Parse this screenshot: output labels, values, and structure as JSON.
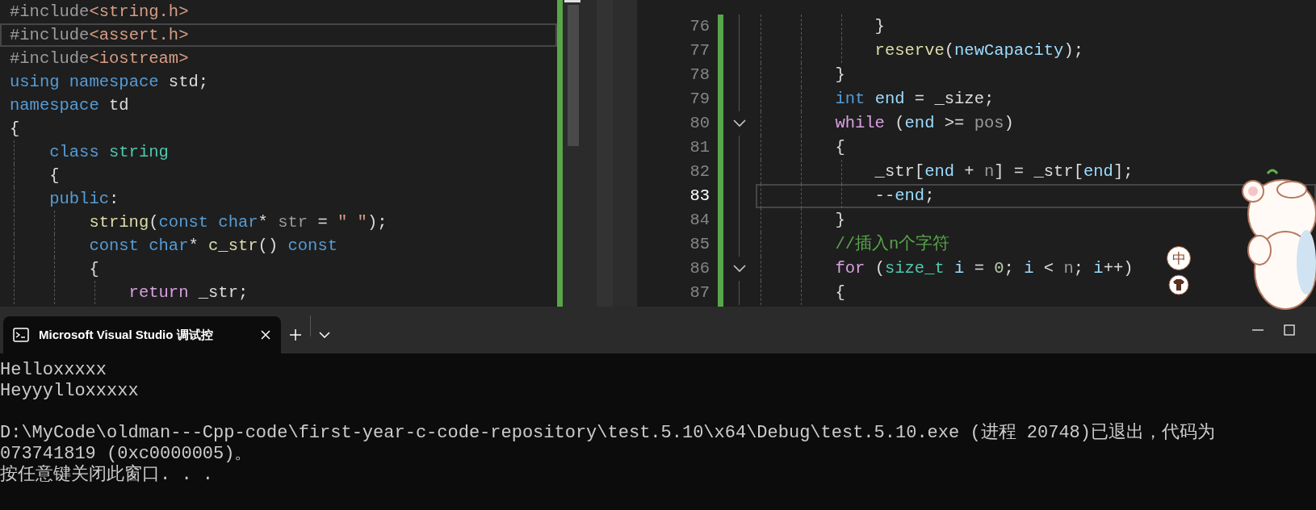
{
  "left_editor": {
    "lines": [
      {
        "current": false,
        "tokens": [
          {
            "t": "#include",
            "kind": "prep"
          },
          {
            "t": "<string.h>",
            "kind": "string"
          }
        ]
      },
      {
        "current": true,
        "tokens": [
          {
            "t": "#include",
            "kind": "prep"
          },
          {
            "t": "<assert.h>",
            "kind": "string"
          }
        ]
      },
      {
        "current": false,
        "tokens": [
          {
            "t": "#include",
            "kind": "prep"
          },
          {
            "t": "<iostream>",
            "kind": "string"
          }
        ]
      },
      {
        "current": false,
        "tokens": [
          {
            "t": "using",
            "kind": "kw"
          },
          {
            "t": " namespace",
            "kind": "kw"
          },
          {
            "t": " std;",
            "kind": "plain"
          }
        ]
      },
      {
        "current": false,
        "tokens": [
          {
            "t": "namespace",
            "kind": "kw"
          },
          {
            "t": " td",
            "kind": "plain"
          }
        ]
      },
      {
        "current": false,
        "tokens": [
          {
            "t": "{",
            "kind": "plain"
          }
        ]
      },
      {
        "current": false,
        "tokens": [
          {
            "t": "    class",
            "kind": "kw"
          },
          {
            "t": " string",
            "kind": "type"
          }
        ]
      },
      {
        "current": false,
        "tokens": [
          {
            "t": "    {",
            "kind": "plain"
          }
        ]
      },
      {
        "current": false,
        "tokens": [
          {
            "t": "    public",
            "kind": "kw"
          },
          {
            "t": ":",
            "kind": "plain"
          }
        ]
      },
      {
        "current": false,
        "tokens": [
          {
            "t": "        string",
            "kind": "func"
          },
          {
            "t": "(",
            "kind": "plain"
          },
          {
            "t": "const",
            "kind": "kw"
          },
          {
            "t": " char",
            "kind": "kw"
          },
          {
            "t": "* ",
            "kind": "plain"
          },
          {
            "t": "str",
            "kind": "param"
          },
          {
            "t": " = ",
            "kind": "plain"
          },
          {
            "t": "\" \"",
            "kind": "string"
          },
          {
            "t": ");",
            "kind": "plain"
          }
        ]
      },
      {
        "current": false,
        "tokens": [
          {
            "t": "        const",
            "kind": "kw"
          },
          {
            "t": " char",
            "kind": "kw"
          },
          {
            "t": "* ",
            "kind": "plain"
          },
          {
            "t": "c_str",
            "kind": "func"
          },
          {
            "t": "() ",
            "kind": "plain"
          },
          {
            "t": "const",
            "kind": "kw"
          }
        ]
      },
      {
        "current": false,
        "tokens": [
          {
            "t": "        {",
            "kind": "plain"
          }
        ]
      },
      {
        "current": false,
        "tokens": [
          {
            "t": "            return",
            "kind": "ctrl"
          },
          {
            "t": " _str;",
            "kind": "plain"
          }
        ]
      }
    ]
  },
  "right_editor": {
    "lines": [
      {
        "number": "76",
        "current": false,
        "foldable": false,
        "tokens": [
          {
            "t": "            }",
            "kind": "plain"
          }
        ]
      },
      {
        "number": "77",
        "current": false,
        "foldable": false,
        "tokens": [
          {
            "t": "            reserve",
            "kind": "func"
          },
          {
            "t": "(",
            "kind": "plain"
          },
          {
            "t": "newCapacity",
            "kind": "var"
          },
          {
            "t": ");",
            "kind": "plain"
          }
        ]
      },
      {
        "number": "78",
        "current": false,
        "foldable": false,
        "tokens": [
          {
            "t": "        }",
            "kind": "plain"
          }
        ]
      },
      {
        "number": "79",
        "current": false,
        "foldable": false,
        "tokens": [
          {
            "t": "        int",
            "kind": "kw"
          },
          {
            "t": " end",
            "kind": "var"
          },
          {
            "t": " = _size;",
            "kind": "plain"
          }
        ]
      },
      {
        "number": "80",
        "current": false,
        "foldable": true,
        "tokens": [
          {
            "t": "        while",
            "kind": "ctrl"
          },
          {
            "t": " (",
            "kind": "plain"
          },
          {
            "t": "end",
            "kind": "var"
          },
          {
            "t": " >= ",
            "kind": "plain"
          },
          {
            "t": "pos",
            "kind": "param"
          },
          {
            "t": ")",
            "kind": "plain"
          }
        ]
      },
      {
        "number": "81",
        "current": false,
        "foldable": false,
        "tokens": [
          {
            "t": "        {",
            "kind": "plain"
          }
        ]
      },
      {
        "number": "82",
        "current": false,
        "foldable": false,
        "tokens": [
          {
            "t": "            _str[",
            "kind": "plain"
          },
          {
            "t": "end",
            "kind": "var"
          },
          {
            "t": " + ",
            "kind": "plain"
          },
          {
            "t": "n",
            "kind": "param"
          },
          {
            "t": "] = _str[",
            "kind": "plain"
          },
          {
            "t": "end",
            "kind": "var"
          },
          {
            "t": "];",
            "kind": "plain"
          }
        ]
      },
      {
        "number": "83",
        "current": true,
        "foldable": false,
        "tokens": [
          {
            "t": "            --",
            "kind": "plain"
          },
          {
            "t": "end",
            "kind": "var"
          },
          {
            "t": ";",
            "kind": "plain"
          }
        ]
      },
      {
        "number": "84",
        "current": false,
        "foldable": false,
        "tokens": [
          {
            "t": "        }",
            "kind": "plain"
          }
        ]
      },
      {
        "number": "85",
        "current": false,
        "foldable": false,
        "tokens": [
          {
            "t": "        //插入n个字符",
            "kind": "comment"
          }
        ]
      },
      {
        "number": "86",
        "current": false,
        "foldable": true,
        "tokens": [
          {
            "t": "        for",
            "kind": "ctrl"
          },
          {
            "t": " (",
            "kind": "plain"
          },
          {
            "t": "size_t",
            "kind": "type"
          },
          {
            "t": " i",
            "kind": "var"
          },
          {
            "t": " = ",
            "kind": "plain"
          },
          {
            "t": "0",
            "kind": "num"
          },
          {
            "t": "; ",
            "kind": "plain"
          },
          {
            "t": "i",
            "kind": "var"
          },
          {
            "t": " < ",
            "kind": "plain"
          },
          {
            "t": "n",
            "kind": "param"
          },
          {
            "t": "; ",
            "kind": "plain"
          },
          {
            "t": "i",
            "kind": "var"
          },
          {
            "t": "++)",
            "kind": "plain"
          }
        ]
      },
      {
        "number": "87",
        "current": false,
        "foldable": false,
        "tokens": [
          {
            "t": "        {",
            "kind": "plain"
          }
        ]
      }
    ]
  },
  "ime": {
    "label": "中"
  },
  "terminal": {
    "tab": {
      "title": "Microsoft Visual Studio 调试控",
      "selected": true
    },
    "output": [
      "Helloxxxxx",
      "Heyyylloxxxxx"
    ],
    "messages": [
      "D:\\MyCode\\oldman---Cpp-code\\first-year-c-code-repository\\test.5.10\\x64\\Debug\\test.5.10.exe (进程 20748)已退出，代码为",
      "073741819 (0xc0000005)。",
      "按任意键关闭此窗口. . ."
    ]
  }
}
